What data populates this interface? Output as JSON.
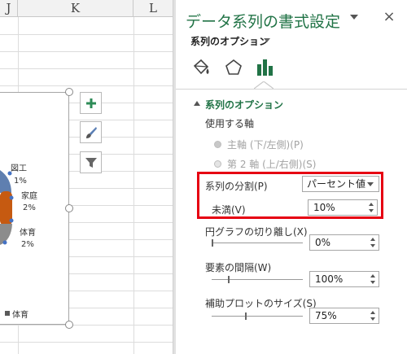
{
  "sheet": {
    "columns": [
      "J",
      "K",
      "L"
    ],
    "chart": {
      "labels": [
        {
          "name": "図工",
          "percent": "1%"
        },
        {
          "name": "家庭",
          "percent": "2%"
        },
        {
          "name": "体育",
          "percent": "2%"
        }
      ],
      "legend_label": "体育"
    },
    "side_buttons": [
      "plus-icon",
      "brush-icon",
      "filter-icon"
    ]
  },
  "pane": {
    "title": "データ系列の書式設定",
    "close_label": "×",
    "subtitle": "系列のオプション",
    "icon_tabs": [
      "fill-line-icon",
      "effects-pentagon-icon",
      "series-options-bar-icon"
    ],
    "section_title": "系列のオプション",
    "axis_label": "使用する軸",
    "primary_axis": "主軸 (下/左側)(P)",
    "secondary_axis": "第 2 軸 (上/右側)(S)",
    "split_series_label": "系列の分割(P)",
    "split_series_value": "パーセント値",
    "less_than_label": "未満(V)",
    "less_than_value": "10%",
    "pie_explosion_label": "円グラフの切り離し(X)",
    "pie_explosion_value": "0%",
    "gap_width_label": "要素の間隔(W)",
    "gap_width_value": "100%",
    "second_plot_size_label": "補助プロットのサイズ(S)",
    "second_plot_size_value": "75%",
    "accent_color": "#217346",
    "highlight_color": "#e60012"
  }
}
